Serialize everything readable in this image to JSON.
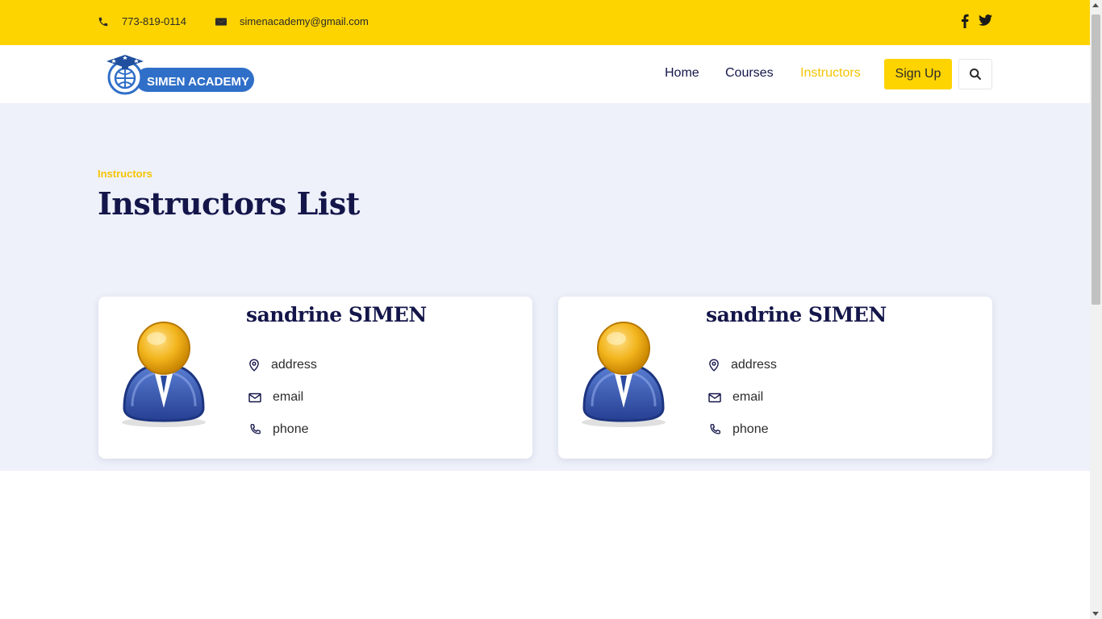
{
  "topbar": {
    "phone": "773-819-0114",
    "email": "simenacademy@gmail.com",
    "phone_icon": "phone-icon",
    "email_icon": "envelope-icon",
    "social": [
      "facebook-icon",
      "twitter-icon"
    ]
  },
  "brand": {
    "logo_text": "SIMEN ACADEMY"
  },
  "nav": {
    "items": [
      {
        "label": "Home",
        "active": false
      },
      {
        "label": "Courses",
        "active": false
      },
      {
        "label": "Instructors",
        "active": true
      }
    ],
    "signup_label": "Sign Up",
    "search_icon": "search-icon"
  },
  "header": {
    "eyebrow": "Instructors",
    "title": "Instructors List"
  },
  "instructors": [
    {
      "name": "sandrine SIMEN",
      "address": "address",
      "email": "email",
      "phone": "phone"
    },
    {
      "name": "sandrine SIMEN",
      "address": "address",
      "email": "email",
      "phone": "phone"
    }
  ],
  "colors": {
    "accent_yellow": "#fdd300",
    "active_link": "#f5c400",
    "navy": "#14164a",
    "hero_bg": "#eef1fa",
    "logo_blue": "#2f6fc8"
  }
}
